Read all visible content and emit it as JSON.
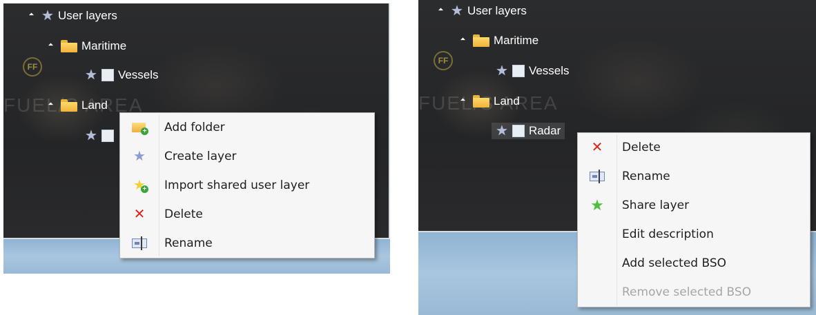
{
  "left_panel": {
    "tree": {
      "root": {
        "label": "User layers",
        "icon": "star-icon"
      },
      "folders": [
        {
          "label": "Maritime",
          "icon": "folder-icon",
          "layers": [
            {
              "label": "Vessels"
            }
          ]
        },
        {
          "label": "Land",
          "icon": "folder-icon",
          "layers": [
            {
              "label": ""
            }
          ]
        }
      ]
    },
    "context_menu": {
      "items": [
        {
          "label": "Add folder",
          "icon": "folder-add-icon",
          "enabled": true
        },
        {
          "label": "Create layer",
          "icon": "star-blue-icon",
          "enabled": true
        },
        {
          "label": "Import shared user layer",
          "icon": "star-add-icon",
          "enabled": true
        },
        {
          "label": "Delete",
          "icon": "delete-x-icon",
          "enabled": true
        },
        {
          "label": "Rename",
          "icon": "rename-icon",
          "enabled": true
        }
      ]
    }
  },
  "right_panel": {
    "tree": {
      "root": {
        "label": "User layers",
        "icon": "star-icon"
      },
      "folders": [
        {
          "label": "Maritime",
          "icon": "folder-icon",
          "layers": [
            {
              "label": "Vessels"
            }
          ]
        },
        {
          "label": "Land",
          "icon": "folder-icon",
          "layers": [
            {
              "label": "Radar"
            }
          ]
        }
      ]
    },
    "context_menu": {
      "items": [
        {
          "label": "Delete",
          "icon": "delete-x-icon",
          "enabled": true
        },
        {
          "label": "Rename",
          "icon": "rename-icon",
          "enabled": true
        },
        {
          "label": "Share layer",
          "icon": "star-green-icon",
          "enabled": true
        },
        {
          "label": "Edit description",
          "icon": "",
          "enabled": true
        },
        {
          "label": "Add selected BSO",
          "icon": "",
          "enabled": true
        },
        {
          "label": "Remove selected BSO",
          "icon": "",
          "enabled": false
        }
      ]
    }
  },
  "map_overlay_text": "FUEL/S AREA",
  "colors": {
    "menu_bg": "#f6f6f6",
    "map_bg": "#2b2c2e",
    "sea": "#9ab9d5",
    "delete_red": "#d9261c",
    "share_green": "#4cbf3c",
    "disabled_text": "#a6a6a6"
  }
}
